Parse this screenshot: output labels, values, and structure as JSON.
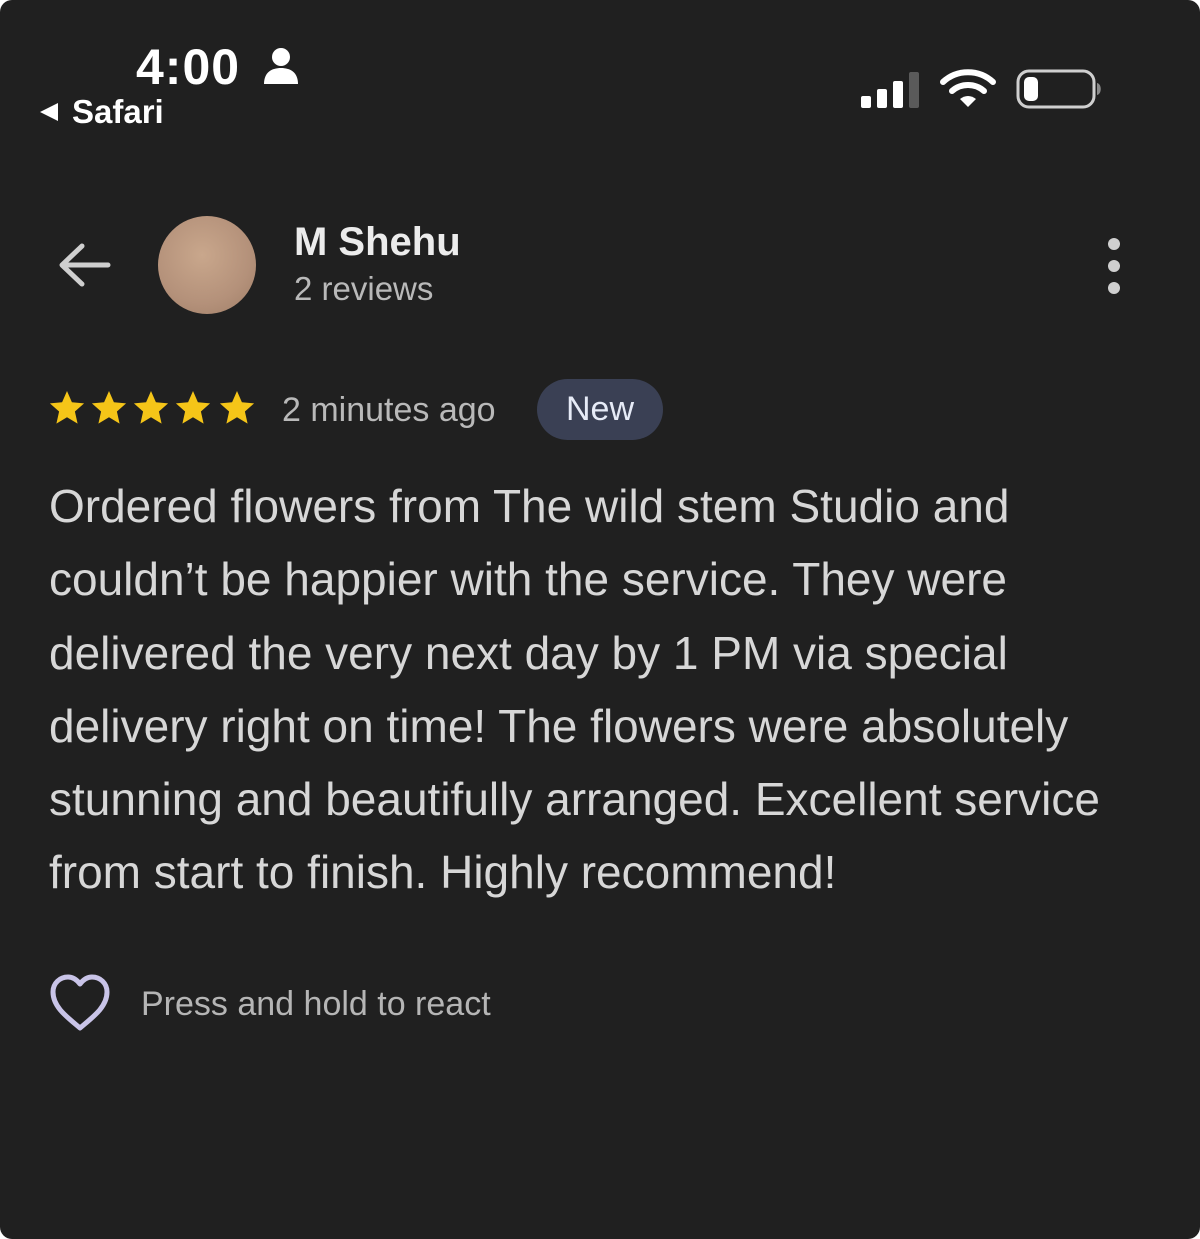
{
  "status_bar": {
    "time": "4:00",
    "back_app_label": "Safari",
    "icons": [
      "person-icon",
      "signal-icon",
      "wifi-icon",
      "battery-icon"
    ]
  },
  "header": {
    "back_icon": "arrow-left-icon",
    "reviewer_name": "M Shehu",
    "reviewer_reviews": "2 reviews",
    "more_icon": "more-vertical-icon"
  },
  "review": {
    "rating": 5,
    "rating_max": 5,
    "time_ago": "2 minutes ago",
    "badge": "New",
    "text": "Ordered flowers from The wild stem Studio and couldn’t be happier with the service. They were delivered the very next day by 1 PM via special delivery right on time! The flowers were absolutely stunning and beautifully arranged. Excellent service from start to finish. Highly recommend!"
  },
  "reaction": {
    "icon": "heart-outline-icon",
    "label": "Press and hold to react"
  },
  "colors": {
    "background": "#202020",
    "star": "#f5c518",
    "badge_bg": "#3a4054",
    "heart": "#c9c4e8"
  }
}
